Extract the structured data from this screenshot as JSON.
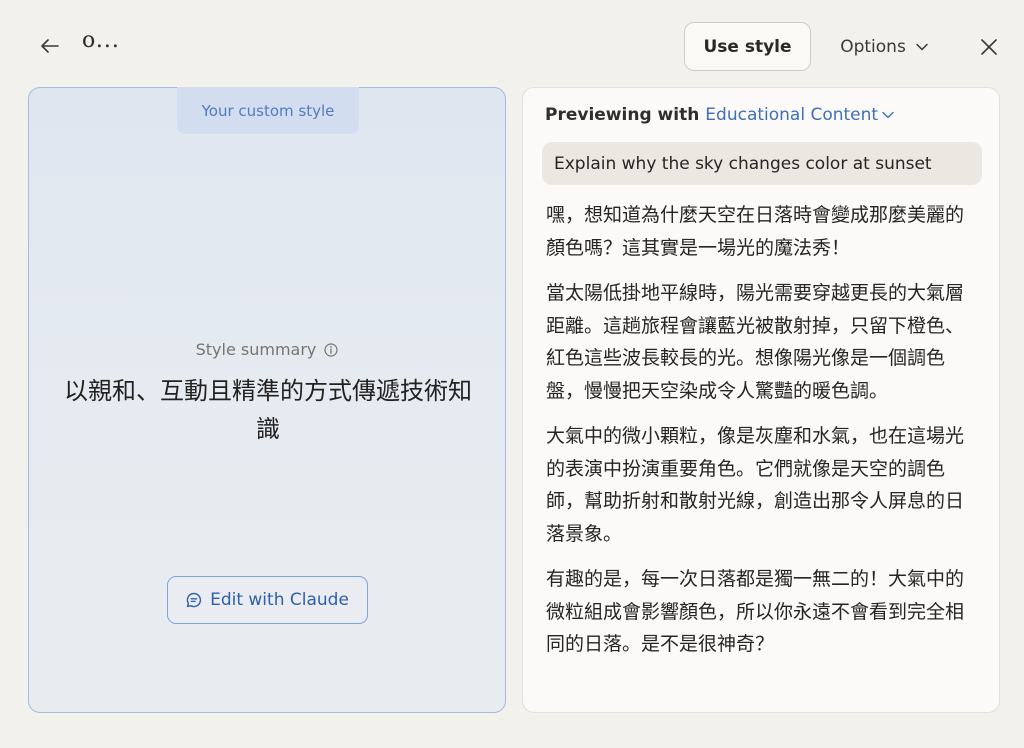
{
  "header": {
    "title": "o...",
    "use_style_label": "Use style",
    "options_label": "Options"
  },
  "left": {
    "custom_tab_label": "Your custom style",
    "summary_label": "Style summary",
    "summary_text": "以親和、互動且精準的方式傳遞技術知識",
    "edit_label": "Edit with Claude"
  },
  "right": {
    "previewing_label": "Previewing with",
    "preview_selection": "Educational Content",
    "prompt": "Explain why the sky changes color at sunset",
    "paragraphs": [
      "嘿，想知道為什麼天空在日落時會變成那麼美麗的顏色嗎？這其實是一場光的魔法秀！",
      "當太陽低掛地平線時，陽光需要穿越更長的大氣層距離。這趟旅程會讓藍光被散射掉，只留下橙色、紅色這些波長較長的光。想像陽光像是一個調色盤，慢慢把天空染成令人驚豔的暖色調。",
      "大氣中的微小顆粒，像是灰塵和水氣，也在這場光的表演中扮演重要角色。它們就像是天空的調色師，幫助折射和散射光線，創造出那令人屏息的日落景象。",
      "有趣的是，每一次日落都是獨一無二的！大氣中的微粒組成會影響顏色，所以你永遠不會看到完全相同的日落。是不是很神奇？"
    ]
  },
  "colors": {
    "accent": "#3e6fb8",
    "panel_border": "#9dbde6",
    "background": "#f3f1ec"
  },
  "icons": {
    "back": "arrow-left-icon",
    "options": "chevron-down-icon",
    "close": "close-icon",
    "info": "info-icon",
    "chat": "chat-bubble-icon"
  }
}
